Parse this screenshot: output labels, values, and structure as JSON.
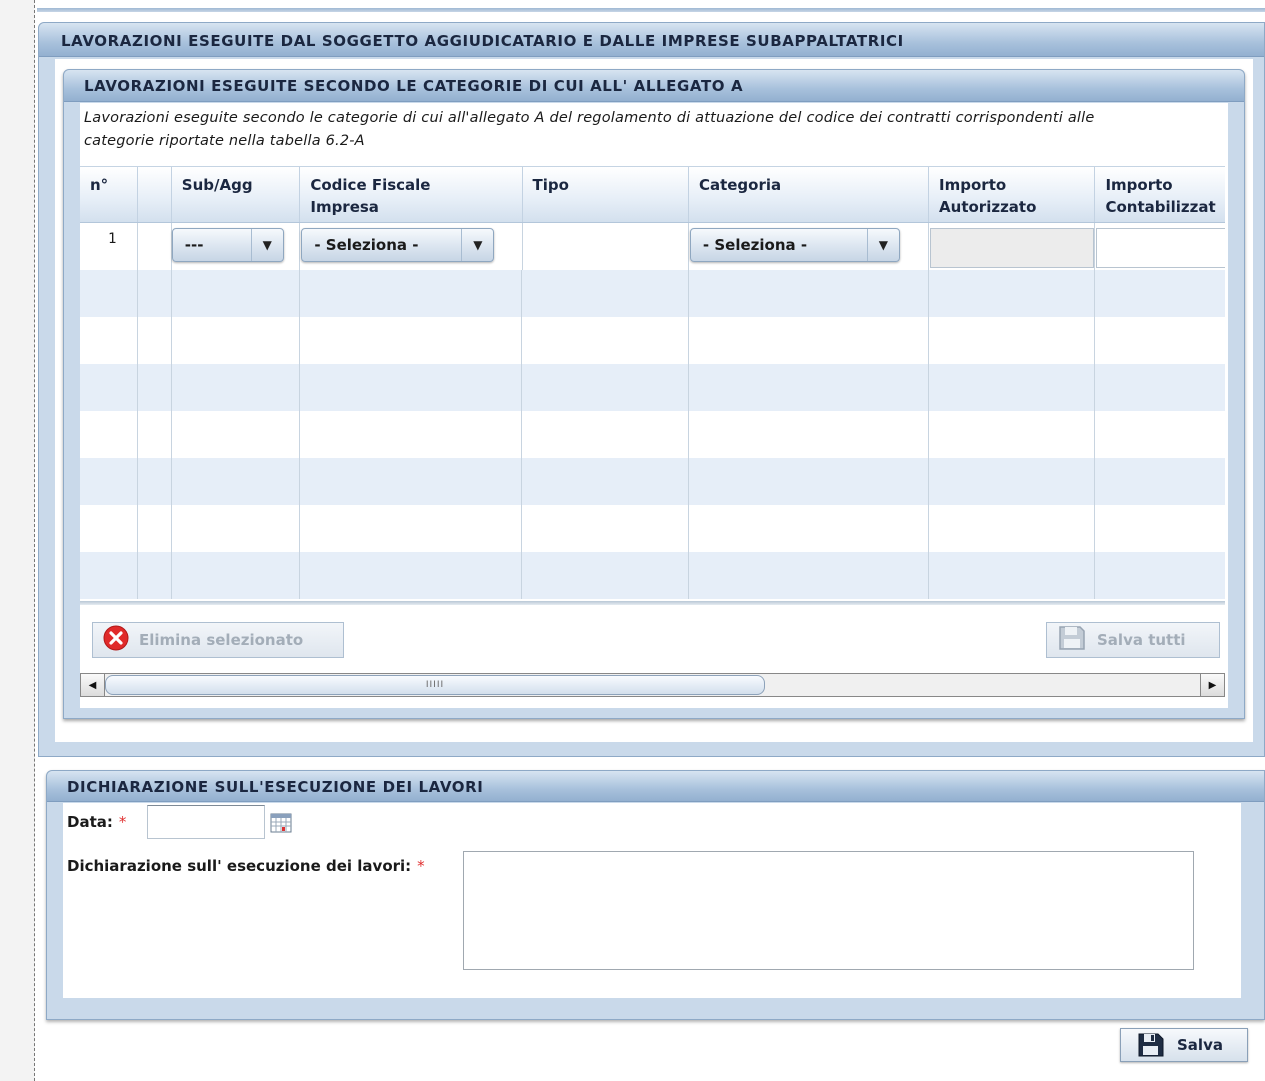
{
  "main_panel": {
    "title": "LAVORAZIONI ESEGUITE DAL SOGGETTO AGGIUDICATARIO E DALLE IMPRESE SUBAPPALTATRICI"
  },
  "categories_panel": {
    "title": "LAVORAZIONI ESEGUITE SECONDO LE CATEGORIE DI CUI ALL' ALLEGATO A",
    "description_line1": "Lavorazioni eseguite secondo le categorie di cui all'allegato A del regolamento di attuazione del codice dei contratti corrispondenti alle",
    "description_line2": "categorie riportate nella tabella 6.2-A"
  },
  "grid": {
    "columns": {
      "num": "n°",
      "check": "",
      "sub_agg": "Sub/Agg",
      "codice_fiscale_1": "Codice Fiscale",
      "codice_fiscale_2": "Impresa",
      "tipo": "Tipo",
      "categoria": "Categoria",
      "importo_aut_1": "Importo",
      "importo_aut_2": "Autorizzato",
      "importo_cont_1": "Importo",
      "importo_cont_2": "Contabilizzat"
    },
    "rows": [
      {
        "num": "1",
        "sub_agg": "---",
        "codice_fiscale": "- Seleziona -",
        "tipo": "",
        "categoria": "- Seleziona -",
        "importo_autorizzato": "",
        "importo_contabilizzato": ""
      }
    ],
    "empty_rows": 7
  },
  "toolbar": {
    "delete_label": "Elimina selezionato",
    "save_all_label": "Salva tutti"
  },
  "scrollbar": {
    "grip": "IIIII"
  },
  "declaration_panel": {
    "title": "DICHIARAZIONE SULL'ESECUZIONE DEI LAVORI",
    "date_label": "Data:",
    "date_value": "",
    "required_mark": "*",
    "declaration_label": "Dichiarazione sull' esecuzione dei lavori:",
    "declaration_value": ""
  },
  "footer": {
    "save_label": "Salva"
  },
  "colors": {
    "header_blue": "#a8c1dc",
    "panel_bg": "#c9d9ea",
    "row_alt": "#e6eef8",
    "required_red": "#e03030",
    "delete_red": "#e02a2a"
  },
  "icons": {
    "delete": "delete-x-icon",
    "save": "floppy-disk-icon",
    "calendar": "calendar-icon"
  }
}
